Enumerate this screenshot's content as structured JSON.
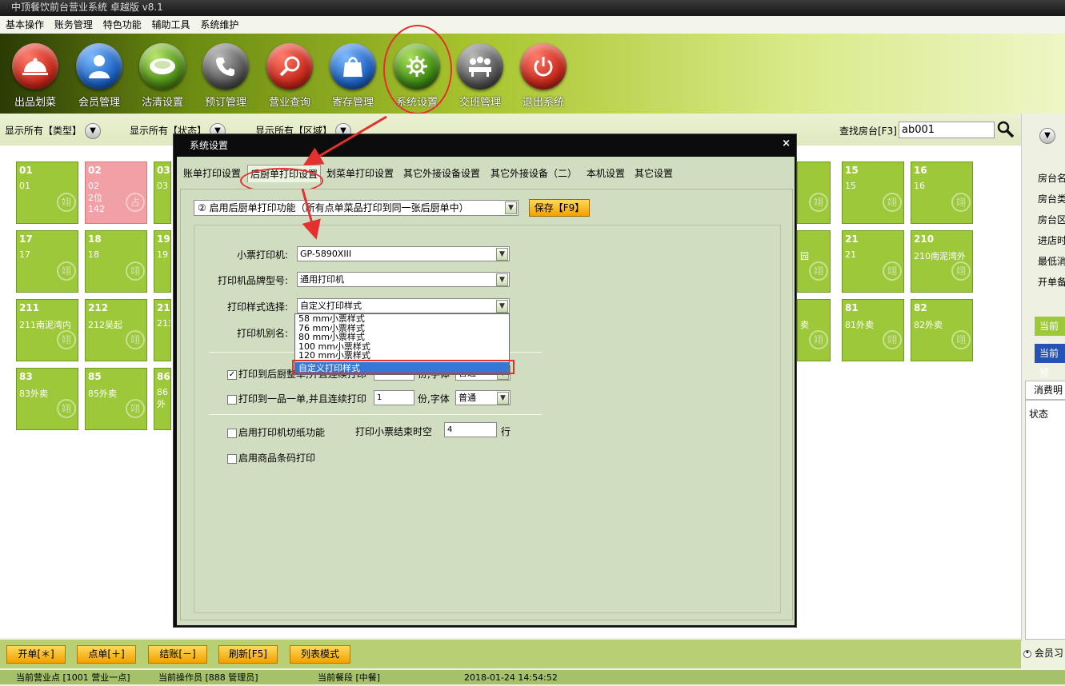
{
  "window_title": "中顶餐饮前台营业系统 卓越版 v8.1",
  "menu": [
    "基本操作",
    "账务管理",
    "特色功能",
    "辅助工具",
    "系统维护"
  ],
  "toolbar": [
    {
      "label": "出品划菜",
      "icon": "dish-cloche-icon",
      "color": "#d23424"
    },
    {
      "label": "会员管理",
      "icon": "member-icon",
      "color": "#2472c9"
    },
    {
      "label": "沽清设置",
      "icon": "plate-icon",
      "color": "#5d9a1c"
    },
    {
      "label": "预订管理",
      "icon": "phone-icon",
      "color": "#555555"
    },
    {
      "label": "营业查询",
      "icon": "search-icon",
      "color": "#d23424"
    },
    {
      "label": "寄存管理",
      "icon": "bag-icon",
      "color": "#2472c9"
    },
    {
      "label": "系统设置",
      "icon": "gear-icon",
      "color": "#4c9a1a"
    },
    {
      "label": "交班管理",
      "icon": "meeting-icon",
      "color": "#555555"
    },
    {
      "label": "退出系统",
      "icon": "power-icon",
      "color": "#d23424"
    }
  ],
  "filters": {
    "type": "显示所有【类型】",
    "status": "显示所有【状态】",
    "area": "显示所有【区域】",
    "search_label": "查找房台[F3]",
    "search_value": "ab001"
  },
  "rooms": [
    {
      "num": "01",
      "name": "01"
    },
    {
      "num": "02",
      "name": "02",
      "extra": "2位",
      "extra2": "142",
      "pink": true
    },
    {
      "num": "03",
      "name": "03"
    },
    {
      "num": "15",
      "name": "15"
    },
    {
      "num": "16",
      "name": "16"
    },
    {
      "num": "17",
      "name": "17"
    },
    {
      "num": "18",
      "name": "18"
    },
    {
      "num": "19",
      "name": "19"
    },
    {
      "num": "21",
      "name": "21"
    },
    {
      "num": "210",
      "name": "210南泥湾外"
    },
    {
      "num": "211",
      "name": "211南泥湾内"
    },
    {
      "num": "212",
      "name": "212吴起"
    },
    {
      "num": "213",
      "name": "213"
    },
    {
      "num": "81",
      "name": "81外卖"
    },
    {
      "num": "82",
      "name": "82外卖"
    },
    {
      "num": "83",
      "name": "83外卖"
    },
    {
      "num": "85",
      "name": "85外卖"
    },
    {
      "num": "86",
      "name": "86外"
    }
  ],
  "room_fragments": {
    "r1": "园",
    "r2": "卖"
  },
  "room_watermark": "翊",
  "room_badge": "占",
  "right_panel": {
    "labels": [
      "房台名",
      "房台类",
      "房台区",
      "进店时",
      "最低消",
      "开单备"
    ],
    "btn1": "当前可",
    "btn2": "当前预",
    "tab": "消费明",
    "col": "状态",
    "bottom": "会员习"
  },
  "bottom_buttons": [
    "开单[＊]",
    "点单[＋]",
    "结账[－]",
    "刷新[F5]",
    "列表模式"
  ],
  "status": {
    "shop": "当前营业点 [1001 营业一点]",
    "operator": "当前操作员 [888 管理员]",
    "period": "当前餐段 [中餐]",
    "datetime": "2018-01-24 14:54:52"
  },
  "dialog": {
    "title": "系统设置",
    "close": "×",
    "tabs": [
      "账单打印设置",
      "后厨单打印设置",
      "划菜单打印设置",
      "其它外接设备设置",
      "其它外接设备（二）",
      "本机设置",
      "其它设置"
    ],
    "active_tab": 1,
    "enable_option": "② 启用后厨单打印功能（所有点单菜品打印到同一张后厨单中）",
    "save_label": "保存【F9】",
    "printer_label": "小票打印机:",
    "printer_value": "GP-5890XIII",
    "brand_label": "打印机品牌型号:",
    "brand_value": "通用打印机",
    "style_label": "打印样式选择:",
    "style_value": "自定义打印样式",
    "alias_label": "打印机别名:",
    "style_options": [
      "58  mm小票样式",
      "76  mm小票样式",
      "80  mm小票样式",
      "100 mm小票样式",
      "120 mm小票样式",
      "自定义打印样式"
    ],
    "print_whole_label": "打印到后厨整单,并且连续打印",
    "print_whole_checked": true,
    "print_whole_count": "1",
    "print_one_label": "打印到一品一单,并且连续打印",
    "print_one_checked": false,
    "print_one_count": "1",
    "copies_font_label": "份,字体",
    "font_value": "普通",
    "cut_label": "启用打印机切纸功能",
    "blank_label": "打印小票结束时空",
    "blank_value": "4",
    "line_unit": "行",
    "barcode_label": "启用商品条码打印"
  }
}
